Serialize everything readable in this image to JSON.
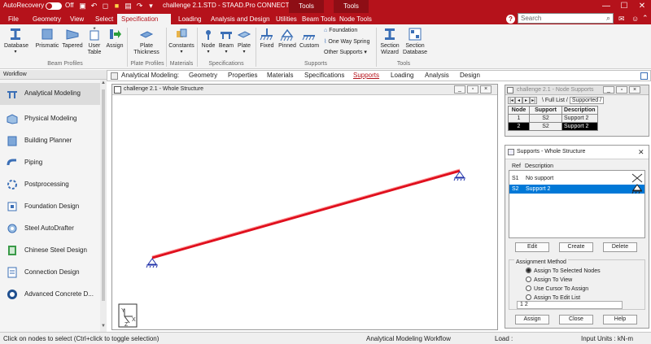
{
  "titlebar": {
    "autorecovery": "AutoRecovery",
    "toggle": "Off",
    "title": "challenge 2.1.STD - STAAD.Pro CONNECT...",
    "context_tabs": [
      "Tools",
      "Tools"
    ]
  },
  "menu": {
    "items": [
      "File",
      "Geometry",
      "View",
      "Select",
      "Specification",
      "Loading",
      "Analysis and Design",
      "Utilities",
      "Beam Tools",
      "Node Tools"
    ],
    "active": "Specification"
  },
  "search": {
    "placeholder": "Search"
  },
  "ribbon": {
    "buttons": [
      "Database",
      "Prismatic",
      "Tapered",
      "User Table",
      "Assign",
      "Plate Thickness",
      "Constants",
      "Node",
      "Beam",
      "Plate",
      "Fixed",
      "Pinned",
      "Custom",
      "Foundation",
      "One Way Spring",
      "Other Supports",
      "Section Wizard",
      "Section Database"
    ],
    "groups": [
      "Beam Profiles",
      "Plate Profiles",
      "Materials",
      "Specifications",
      "Supports",
      "Tools"
    ]
  },
  "subtabs": {
    "label": "Analytical Modeling:",
    "items": [
      "Geometry",
      "Properties",
      "Materials",
      "Specifications",
      "Supports",
      "Loading",
      "Analysis",
      "Design"
    ],
    "active": "Supports"
  },
  "workflow": {
    "title": "Workflow",
    "items": [
      "Analytical Modeling",
      "Physical Modeling",
      "Building Planner",
      "Piping",
      "Postprocessing",
      "Foundation Design",
      "Steel AutoDrafter",
      "Chinese Steel Design",
      "Connection Design",
      "Advanced Concrete D..."
    ]
  },
  "viewport": {
    "title": "challenge 2.1 - Whole Structure",
    "axes": {
      "y": "Y",
      "x": "X",
      "z": "Z"
    }
  },
  "node_supports": {
    "title": "challenge 2.1 - Node Supports",
    "tabs": [
      "Full List",
      "Supported"
    ],
    "columns": [
      "Node",
      "Support",
      "Description"
    ],
    "rows": [
      {
        "node": "1",
        "support": "S2",
        "description": "Support 2"
      },
      {
        "node": "2",
        "support": "S2",
        "description": "Support 2"
      }
    ]
  },
  "supports_dialog": {
    "title": "Supports - Whole Structure",
    "col_ref": "Ref",
    "col_desc": "Description",
    "rows": [
      {
        "ref": "S1",
        "desc": "No support"
      },
      {
        "ref": "S2",
        "desc": "Support 2"
      }
    ],
    "buttons": [
      "Edit",
      "Create",
      "Delete"
    ],
    "assignment_title": "Assignment Method",
    "methods": [
      "Assign To Selected Nodes",
      "Assign To View",
      "Use Cursor To Assign",
      "Assign To Edit List"
    ],
    "edit_list_value": "1 2",
    "bottom_buttons": [
      "Assign",
      "Close",
      "Help"
    ]
  },
  "statusbar": {
    "hint": "Click on nodes to select (Ctrl+click to toggle selection)",
    "workflow": "Analytical Modeling Workflow",
    "load": "Load :",
    "units": "Input Units : kN-m"
  },
  "colors": {
    "brand": "#b5121b",
    "member": "#e0101e",
    "selection": "#0078d7"
  }
}
